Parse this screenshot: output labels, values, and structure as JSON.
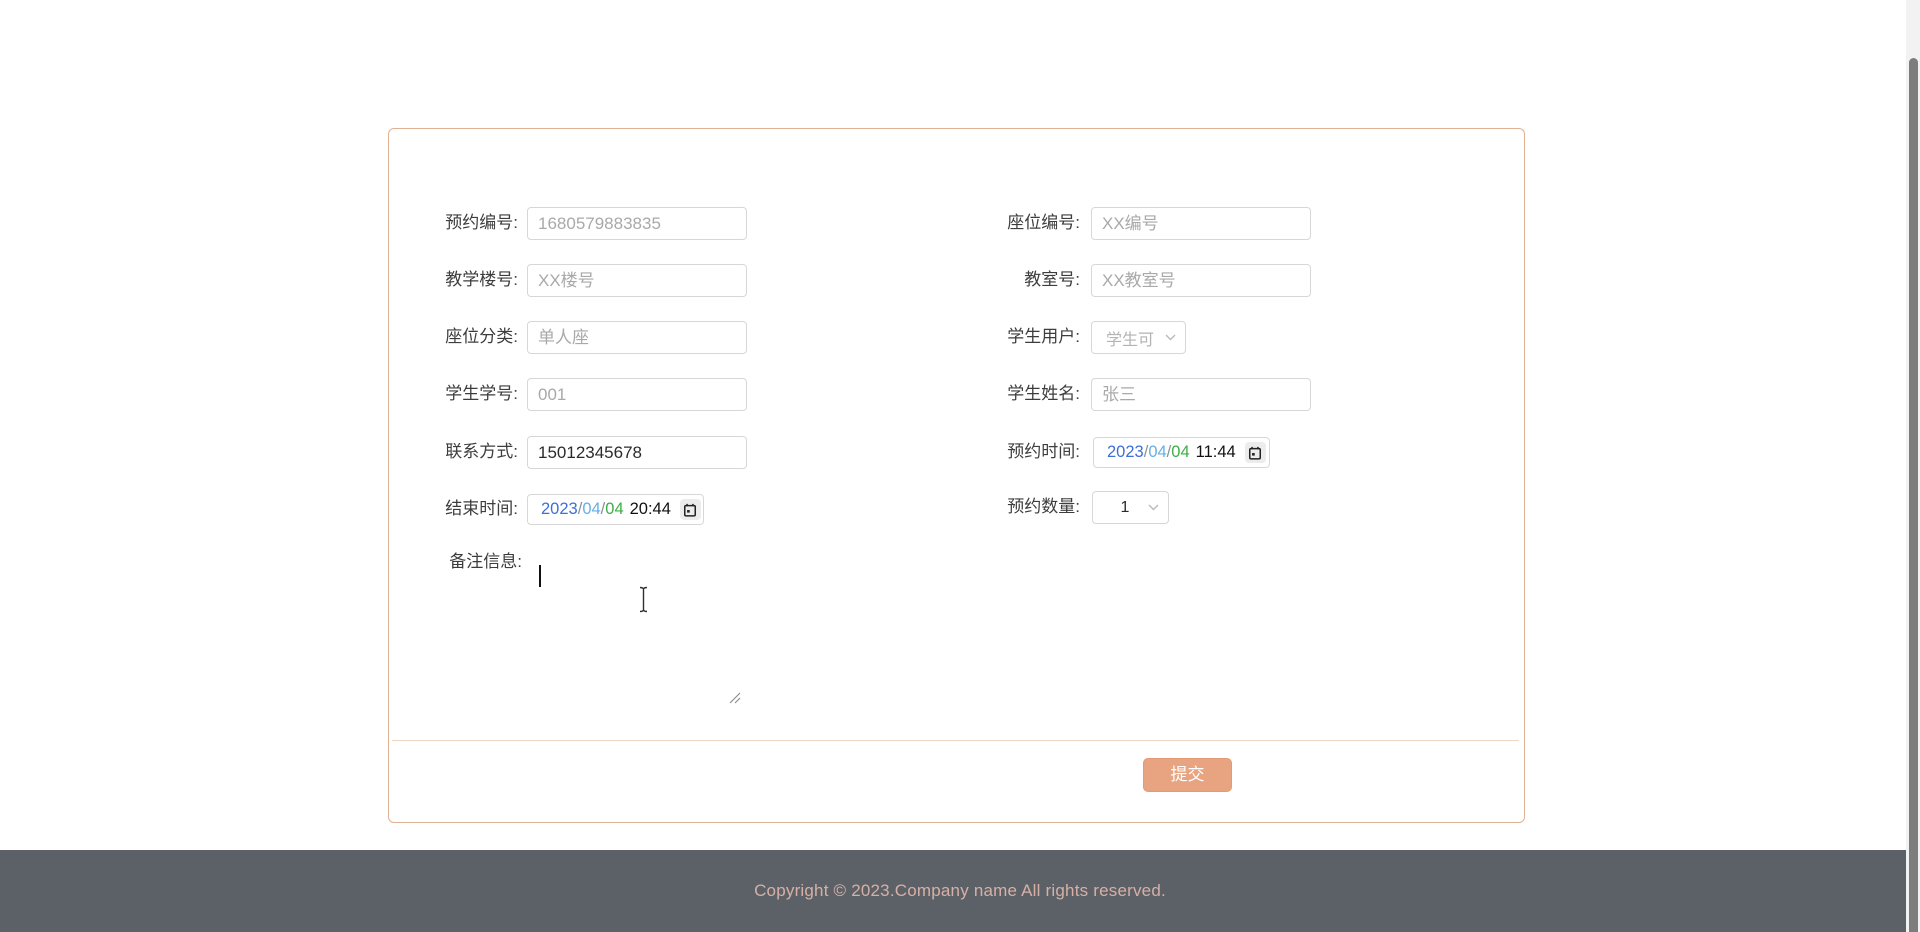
{
  "form": {
    "fields": {
      "reservation_no": {
        "label": "预约编号:",
        "placeholder": "1680579883835"
      },
      "building_no": {
        "label": "教学楼号:",
        "placeholder": "XX楼号"
      },
      "seat_category": {
        "label": "座位分类:",
        "placeholder": "单人座"
      },
      "student_no": {
        "label": "学生学号:",
        "placeholder": "001"
      },
      "contact": {
        "label": "联系方式:",
        "value": "15012345678"
      },
      "end_time": {
        "label": "结束时间:",
        "year": "2023",
        "slash": "/",
        "month": "04",
        "day": "04",
        "time": "20:44"
      },
      "remarks": {
        "label": "备注信息:",
        "value": ""
      },
      "seat_no": {
        "label": "座位编号:",
        "placeholder": "XX编号"
      },
      "classroom_no": {
        "label": "教室号:",
        "placeholder": "XX教室号"
      },
      "student_user": {
        "label": "学生用户:",
        "value": "学生可"
      },
      "student_name": {
        "label": "学生姓名:",
        "placeholder": "张三"
      },
      "reserve_time": {
        "label": "预约时间:",
        "year": "2023",
        "slash": "/",
        "month": "04",
        "day": "04",
        "time": "11:44"
      },
      "quantity": {
        "label": "预约数量:",
        "value": "1"
      }
    },
    "submit_label": "提交"
  },
  "footer": {
    "copyright": "Copyright © 2023.Company name All rights reserved."
  },
  "icons": {
    "calendar": "calendar-icon",
    "chevron": "chevron-down-icon"
  },
  "colors": {
    "accent_button": "#e8a480",
    "card_border": "#e0b192",
    "divider": "#efd6c3",
    "footer_bg": "#5c6167",
    "footer_text": "#d6b0a6",
    "date_year": "#3e6fd8",
    "date_month": "#64afe6",
    "date_day": "#3caf46",
    "placeholder": "#a9a9a9"
  }
}
